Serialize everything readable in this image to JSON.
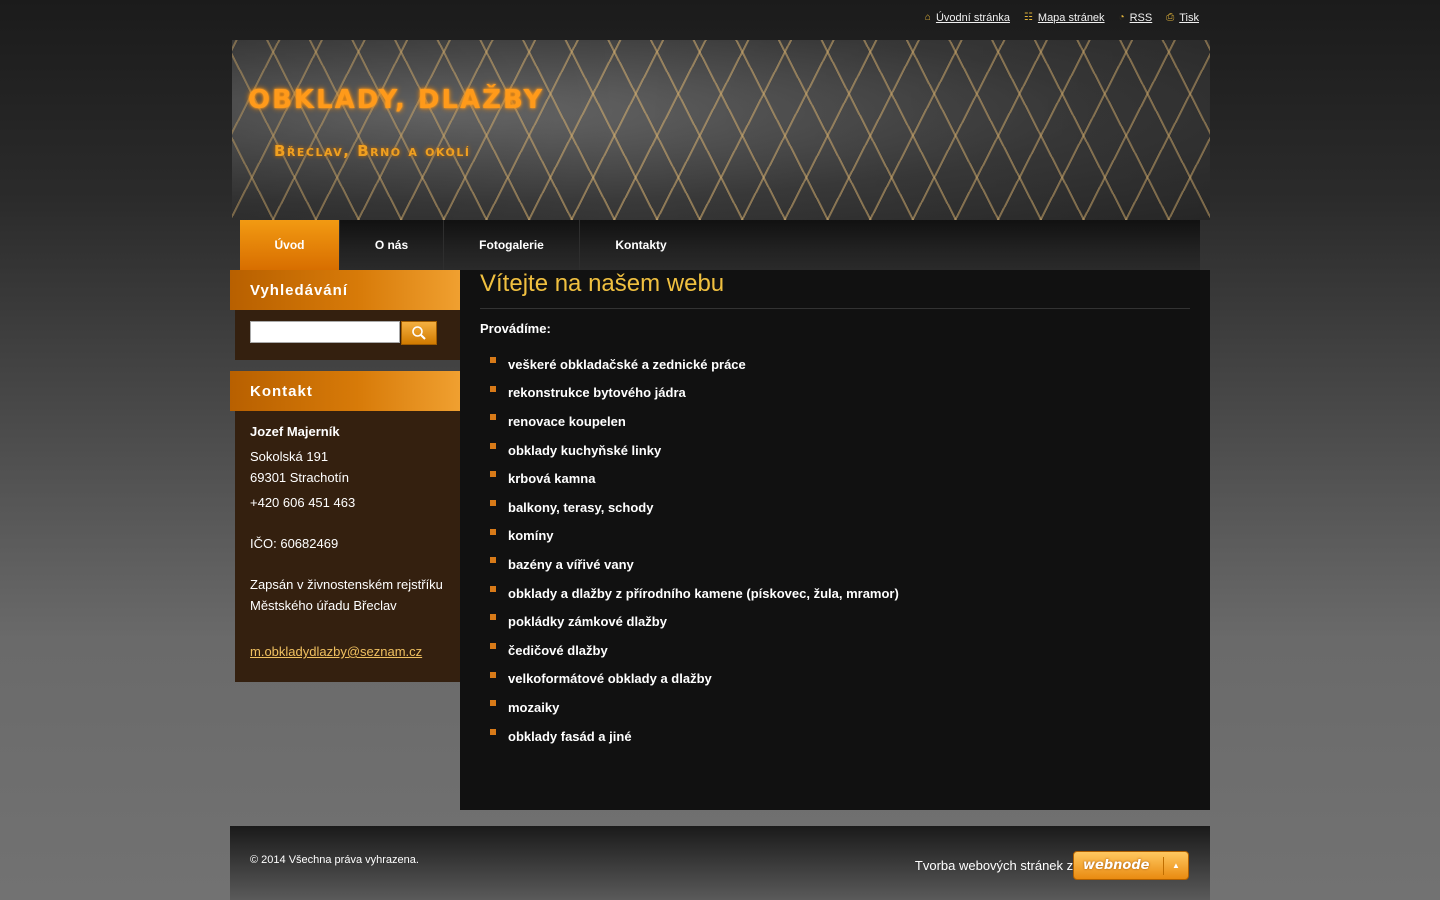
{
  "toplinks": [
    {
      "icon": "home-icon",
      "label": "Úvodní stránka"
    },
    {
      "icon": "sitemap-icon",
      "label": "Mapa stránek"
    },
    {
      "icon": "rss-icon",
      "label": "RSS"
    },
    {
      "icon": "print-icon",
      "label": "Tisk"
    }
  ],
  "header": {
    "title": "OBKLADY, DLAŽBY",
    "slogan": "Břeclav, Brno a okolí"
  },
  "nav": [
    {
      "label": "Úvod",
      "active": true
    },
    {
      "label": "O nás",
      "active": false
    },
    {
      "label": "Fotogalerie",
      "active": false
    },
    {
      "label": "Kontakty",
      "active": false
    }
  ],
  "sidebar": {
    "search_title": "Vyhledávání",
    "search_value": "",
    "contact_title": "Kontakt",
    "contact": {
      "name": "Jozef Majerník",
      "street": "Sokolská 191",
      "city": "69301 Strachotín",
      "phone": "+420 606 451 463",
      "ico": "IČO: 60682469",
      "register_1": "Zapsán v živnostenském rejstříku",
      "register_2": "Městského úřadu Břeclav",
      "email": "m.obkladydlazby@seznam.cz"
    }
  },
  "main": {
    "title": "Vítejte na našem webu",
    "intro": "Provádíme:",
    "services": [
      "veškeré obkladačské a zednické práce",
      "rekonstrukce bytového jádra",
      "renovace koupelen",
      "obklady kuchyňské linky",
      "krbová kamna",
      "balkony, terasy, schody",
      "komíny",
      "bazény a vířivé vany",
      "obklady a dlažby z přírodního kamene (pískovec, žula, mramor)",
      "pokládky zámkové dlažby",
      "čedičové dlažby",
      "velkoformátové obklady a dlažby",
      "mozaiky",
      "obklady fasád a jiné"
    ]
  },
  "footer": {
    "copyright": "© 2014 Všechna práva vyhrazena.",
    "promo": "Tvorba webových stránek zdarma",
    "badge": "webnode"
  },
  "colors": {
    "accent": "#e07f00",
    "title": "#f0c040",
    "link": "#f0c060"
  }
}
